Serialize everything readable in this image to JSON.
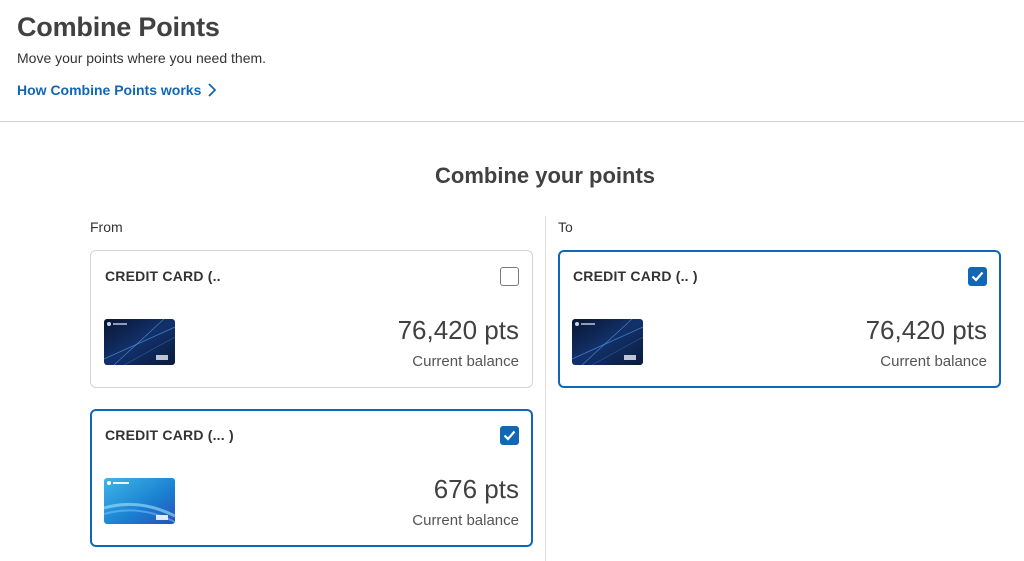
{
  "header": {
    "title": "Combine Points",
    "subtitle": "Move your points where you need them.",
    "help_link": "How Combine Points works"
  },
  "section_title": "Combine your points",
  "from_label": "From",
  "to_label": "To",
  "from_cards": [
    {
      "name": "CREDIT CARD (..",
      "points": "76,420 pts",
      "balance_label": "Current balance",
      "checked": false,
      "art": "dark-card-art"
    },
    {
      "name": "CREDIT CARD (...          )",
      "points": "676 pts",
      "balance_label": "Current balance",
      "checked": true,
      "art": "blue-card-art"
    }
  ],
  "to_cards": [
    {
      "name": "CREDIT CARD (..          )",
      "points": "76,420 pts",
      "balance_label": "Current balance",
      "checked": true,
      "art": "dark-card-art"
    }
  ],
  "colors": {
    "accent": "#1167b5",
    "border": "#d4d4d4",
    "title": "#414042"
  }
}
